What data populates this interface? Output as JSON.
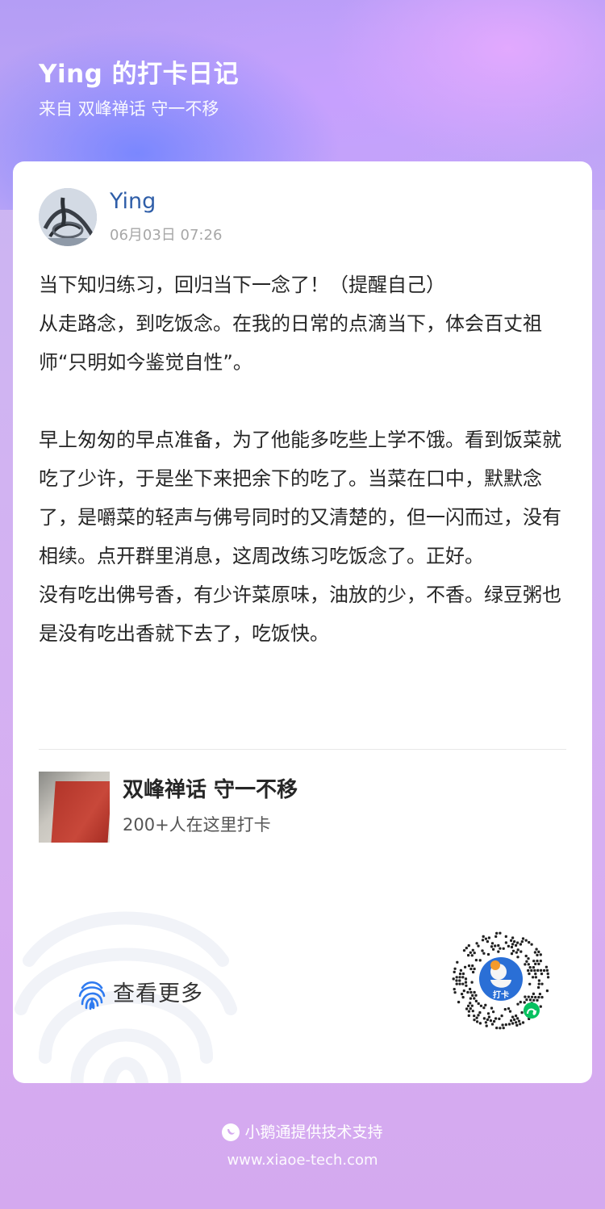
{
  "header": {
    "title": "Ying 的打卡日记",
    "subtitle": "来自 双峰禅话 守一不移"
  },
  "post": {
    "author": "Ying",
    "datetime": "06月03日 07:26",
    "paragraphs": [
      "当下知归练习，回归当下一念了！（提醒自己）",
      "从走路念，到吃饭念。在我的日常的点滴当下，体会百丈祖师“只明如今鉴觉自性”。",
      "",
      "早上匆匆的早点准备，为了他能多吃些上学不饿。看到饭菜就吃了少许，于是坐下来把余下的吃了。当菜在口中，默默念了，是嚼菜的轻声与佛号同时的又清楚的，但一闪而过，没有相续。点开群里消息，这周改练习吃饭念了。正好。",
      "没有吃出佛号香，有少许菜原味，油放的少，不香。绿豆粥也是没有吃出香就下去了，吃饭快。"
    ]
  },
  "group": {
    "name": "双峰禅话 守一不移",
    "count": "200+人在这里打卡"
  },
  "actions": {
    "see_more": "查看更多",
    "qr_badge": "打卡"
  },
  "footer": {
    "provider": "小鹅通提供技术支持",
    "url": "www.xiaoe-tech.com"
  },
  "colors": {
    "accent": "#2f5ea8",
    "fingerprint": "#2f7bf0",
    "wechat_green": "#07c160"
  },
  "icons": {
    "see_more": "fingerprint-icon",
    "footer": "xiaoe-logo-icon",
    "mini_program": "wechat-mini-program-icon"
  }
}
